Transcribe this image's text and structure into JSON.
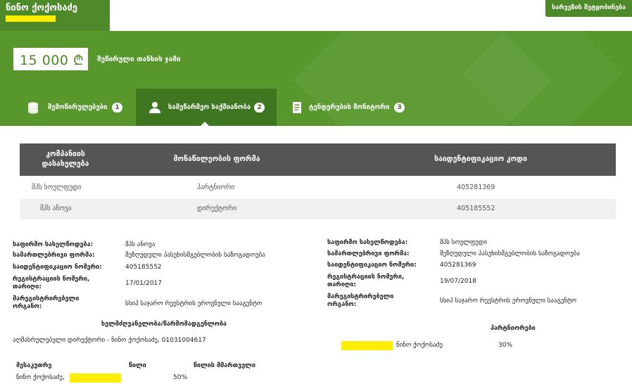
{
  "header": {
    "user_name": "ნინო ქოქოსაძე",
    "notice_button": "ხარვეზის შეტყობინება"
  },
  "summary": {
    "amount": "15 000 ₾",
    "amount_label": "შეწირული თანხის ჯამი"
  },
  "tabs": [
    {
      "label": "შემოწირულებები",
      "count": "1",
      "icon": "coins-icon"
    },
    {
      "label": "სამეწარმეო საქმიანობა",
      "count": "2",
      "icon": "user-icon",
      "active": true
    },
    {
      "label": "ტენდერების მონიტორი",
      "count": "3",
      "icon": "document-icon"
    }
  ],
  "table": {
    "headers": [
      "კომპანიის დასახელება",
      "მონაწილეობის ფორმა",
      "საიდენტიფიკაციო კოდი"
    ],
    "rows": [
      {
        "company": "შპს სოულფუდი",
        "role": "პარტნიორი",
        "code": "405281369"
      },
      {
        "company": "შპს ანოვა",
        "role": "დირექტორი",
        "code": "405185552"
      }
    ]
  },
  "labels": {
    "business_name": "საფირმო სახელწოდება:",
    "legal_form": "სამართლებრივი ფორმა:",
    "id_number": "საიდენტიფიკაციო ნომერი:",
    "reg_number": "რეგისტრაციის ნომერი, თარიღი:",
    "registrar": "მარეგისტრირებელი ორგანო:"
  },
  "companies": [
    {
      "business_name": "შპს ანოვა",
      "legal_form": "შეზღუდული პასუხისმგებლობის საზოგადოება",
      "id_number": "405185552",
      "reg_date": "17/01/2017",
      "registrar": "სსიპ საჯარო რეესტრის ეროვნული სააგენტო",
      "management_title": "ხელმძღვანელობა/წარმომადგენლობა",
      "management_entry": "აღმასრულებელი დირექტორი - ნინო ქოქოსაძე, 01031004617",
      "owners_headers": [
        "მესაკუთრე",
        "წილი",
        "წილის მმართველი"
      ],
      "owners": [
        {
          "name": "ნინო ქოქოსაძე,",
          "share": "50%"
        }
      ]
    },
    {
      "business_name": "შპს სოულფუდი",
      "legal_form": "შეზღუდული პასუხისმგებლობის საზოგადოება",
      "id_number": "405281369",
      "reg_date": "19/07/2018",
      "registrar": "სსიპ საჯარო რეესტრის ეროვნული სააგენტო",
      "partners_title": "პარტნიორები",
      "partners": [
        {
          "name": "ნინო ქოქოსაძე",
          "share": "30%"
        }
      ]
    }
  ],
  "colors": {
    "brand_green": "#57972c",
    "dark_green": "#3f7620",
    "table_header": "#555555",
    "highlight": "#ffee00"
  }
}
